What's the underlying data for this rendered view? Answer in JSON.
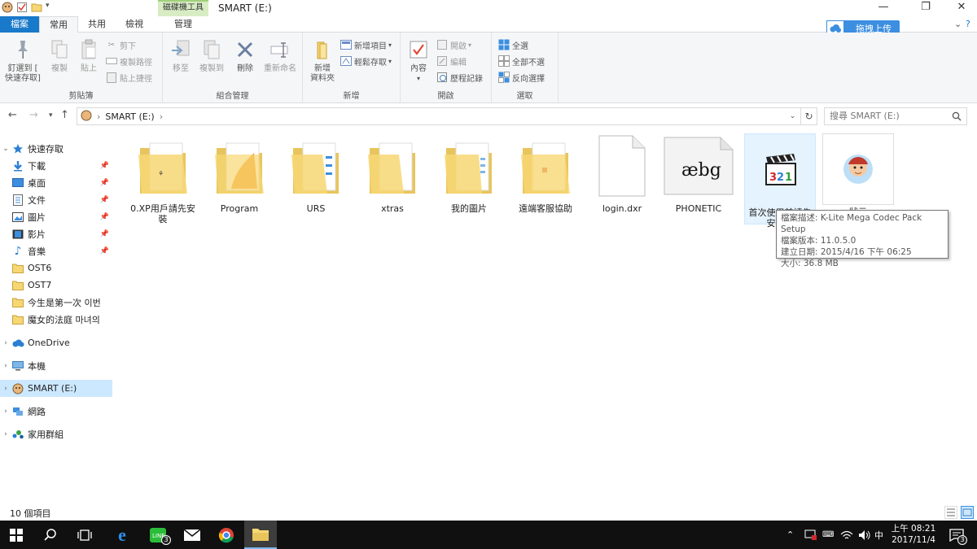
{
  "window": {
    "title": "SMART (E:)",
    "context_tab_group": "磁碟機工具",
    "minimize": "—",
    "maximize": "❐",
    "close": "✕"
  },
  "ribbon_tabs": [
    {
      "label": "檔案"
    },
    {
      "label": "常用"
    },
    {
      "label": "共用"
    },
    {
      "label": "檢視"
    },
    {
      "label": "管理"
    }
  ],
  "upload_button": {
    "label": "拖拽上传"
  },
  "ribbon": {
    "clipboard": {
      "label": "剪貼簿",
      "pin": "釘選到 [\n快速存取]",
      "copy": "複製",
      "paste": "貼上",
      "cut": "剪下",
      "copy_path": "複製路徑",
      "paste_shortcut": "貼上捷徑"
    },
    "organize": {
      "label": "組合管理",
      "move_to": "移至",
      "copy_to": "複製到",
      "delete": "刪除",
      "rename": "重新命名"
    },
    "new": {
      "label": "新增",
      "new_folder": "新增\n資料夾",
      "new_item": "新增項目",
      "easy_access": "輕鬆存取"
    },
    "open": {
      "label": "開啟",
      "properties": "內容",
      "open": "開啟",
      "edit": "編輯",
      "history": "歷程記錄"
    },
    "select": {
      "label": "選取",
      "select_all": "全選",
      "select_none": "全部不選",
      "invert": "反向選擇"
    }
  },
  "address": {
    "path": "SMART (E:)",
    "search_placeholder": "搜尋 SMART (E:)"
  },
  "nav_pane": {
    "quick_access": "快速存取",
    "items": [
      {
        "label": "下載"
      },
      {
        "label": "桌面"
      },
      {
        "label": "文件"
      },
      {
        "label": "圖片"
      },
      {
        "label": "影片"
      },
      {
        "label": "音樂"
      },
      {
        "label": "OST6"
      },
      {
        "label": "OST7"
      },
      {
        "label": "今生是第一次 이번"
      },
      {
        "label": "魔女的法庭 마녀의"
      }
    ],
    "onedrive": "OneDrive",
    "this_pc": "本機",
    "smart": "SMART (E:)",
    "network": "網路",
    "homegroup": "家用群組"
  },
  "files": [
    {
      "name": "0.XP用戶請先安裝",
      "type": "folder"
    },
    {
      "name": "Program",
      "type": "folder"
    },
    {
      "name": "URS",
      "type": "folder"
    },
    {
      "name": "xtras",
      "type": "folder"
    },
    {
      "name": "我的圖片",
      "type": "folder"
    },
    {
      "name": "遠端客服協助",
      "type": "folder"
    },
    {
      "name": "login.dxr",
      "type": "file"
    },
    {
      "name": "PHONETIC",
      "type": "font",
      "preview": "æbg"
    },
    {
      "name": "首次使用前請先安裝本",
      "type": "exe"
    },
    {
      "name": "狀元",
      "type": "app"
    }
  ],
  "tooltip": {
    "line1": "檔案描述: K-Lite Mega Codec Pack Setup",
    "line2": "檔案版本: 11.0.5.0",
    "line3": "建立日期: 2015/4/16 下午 06:25",
    "line4": "大小: 36.8 MB"
  },
  "status": {
    "count": "10 個項目"
  },
  "taskbar": {
    "line_badge": "3",
    "notif_badge": "3",
    "ime": "中",
    "time": "上午 08:21",
    "date": "2017/11/4"
  },
  "colors": {
    "accent": "#1979ca",
    "selection": "#cce8ff",
    "folder": "#f7d774",
    "taskbar": "#101010"
  }
}
